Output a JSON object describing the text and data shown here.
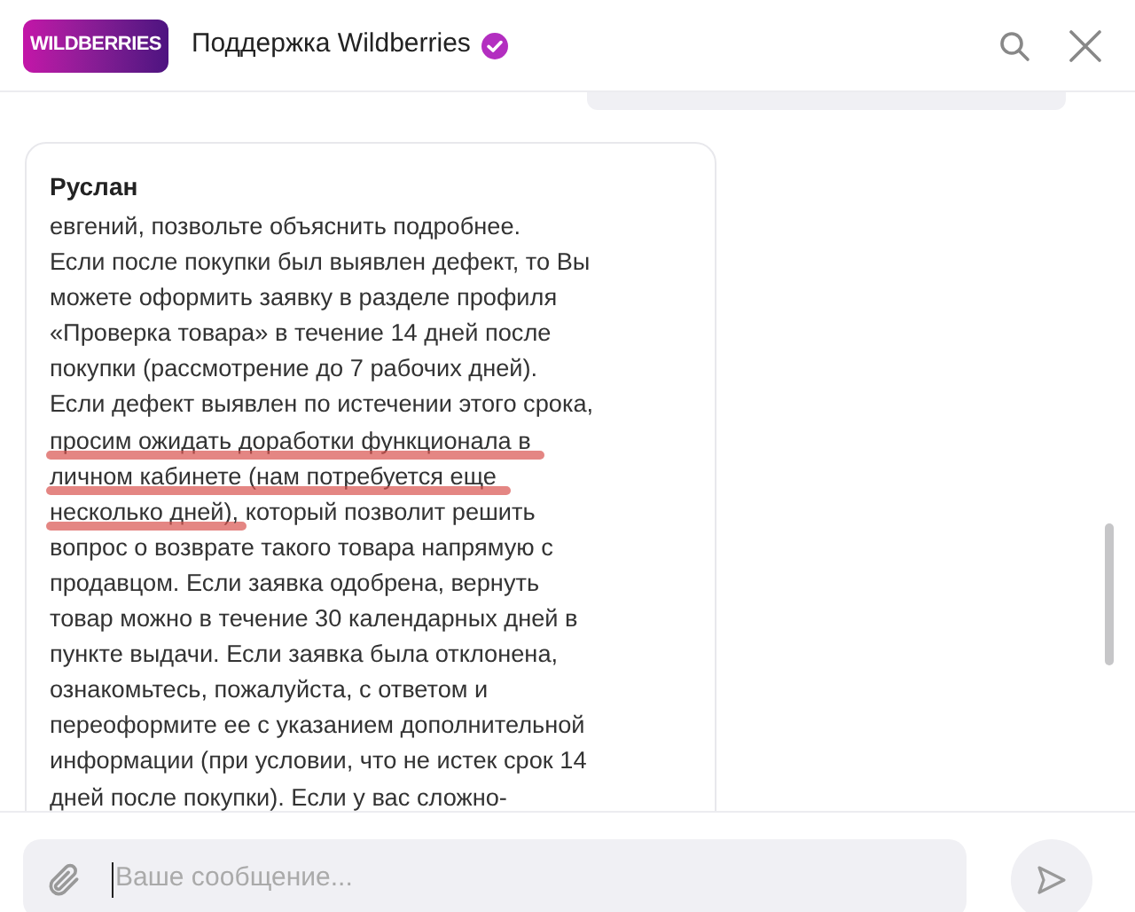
{
  "header": {
    "logo": "WILDBERRIES",
    "title": "Поддержка Wildberries",
    "verified": true
  },
  "message": {
    "author": "Руслан",
    "lines": [
      {
        "parts": [
          {
            "text": "евгений, позвольте объяснить подробнее.",
            "underlined": false
          }
        ]
      },
      {
        "parts": [
          {
            "text": "Если после покупки был выявлен дефект, то Вы",
            "underlined": false
          }
        ]
      },
      {
        "parts": [
          {
            "text": "можете оформить заявку в разделе профиля",
            "underlined": false
          }
        ]
      },
      {
        "parts": [
          {
            "text": "«Проверка товара» в течение 14 дней после",
            "underlined": false
          }
        ]
      },
      {
        "parts": [
          {
            "text": "покупки (рассмотрение до 7 рабочих дней).",
            "underlined": false
          }
        ]
      },
      {
        "parts": [
          {
            "text": "Если дефект выявлен по истечении этого срока,",
            "underlined": false
          }
        ]
      },
      {
        "parts": [
          {
            "text": "просим ожидать доработки функционала в",
            "underlined": true
          }
        ]
      },
      {
        "parts": [
          {
            "text": "личном кабинете (нам потребуется еще",
            "underlined": true
          }
        ]
      },
      {
        "parts": [
          {
            "text": "несколько дней)",
            "underlined": true
          },
          {
            "text": ", который позволит решить",
            "underlined": false
          }
        ]
      },
      {
        "parts": [
          {
            "text": "вопрос о возврате такого товара напрямую с",
            "underlined": false
          }
        ]
      },
      {
        "parts": [
          {
            "text": "продавцом. Если заявка одобрена, вернуть",
            "underlined": false
          }
        ]
      },
      {
        "parts": [
          {
            "text": "товар можно в течение 30 календарных дней в",
            "underlined": false
          }
        ]
      },
      {
        "parts": [
          {
            "text": "пункте выдачи. Если заявка была отклонена,",
            "underlined": false
          }
        ]
      },
      {
        "parts": [
          {
            "text": "ознакомьтесь, пожалуйста, с ответом и",
            "underlined": false
          }
        ]
      },
      {
        "parts": [
          {
            "text": "переоформите ее с указанием дополнительной",
            "underlined": false
          }
        ]
      },
      {
        "parts": [
          {
            "text": "информации (при условии, что не истек срок 14",
            "underlined": false
          }
        ]
      },
      {
        "parts": [
          {
            "text": "дней после покупки). Если у вас сложно-",
            "underlined": false
          }
        ]
      }
    ]
  },
  "composer": {
    "placeholder": "Ваше сообщение..."
  }
}
